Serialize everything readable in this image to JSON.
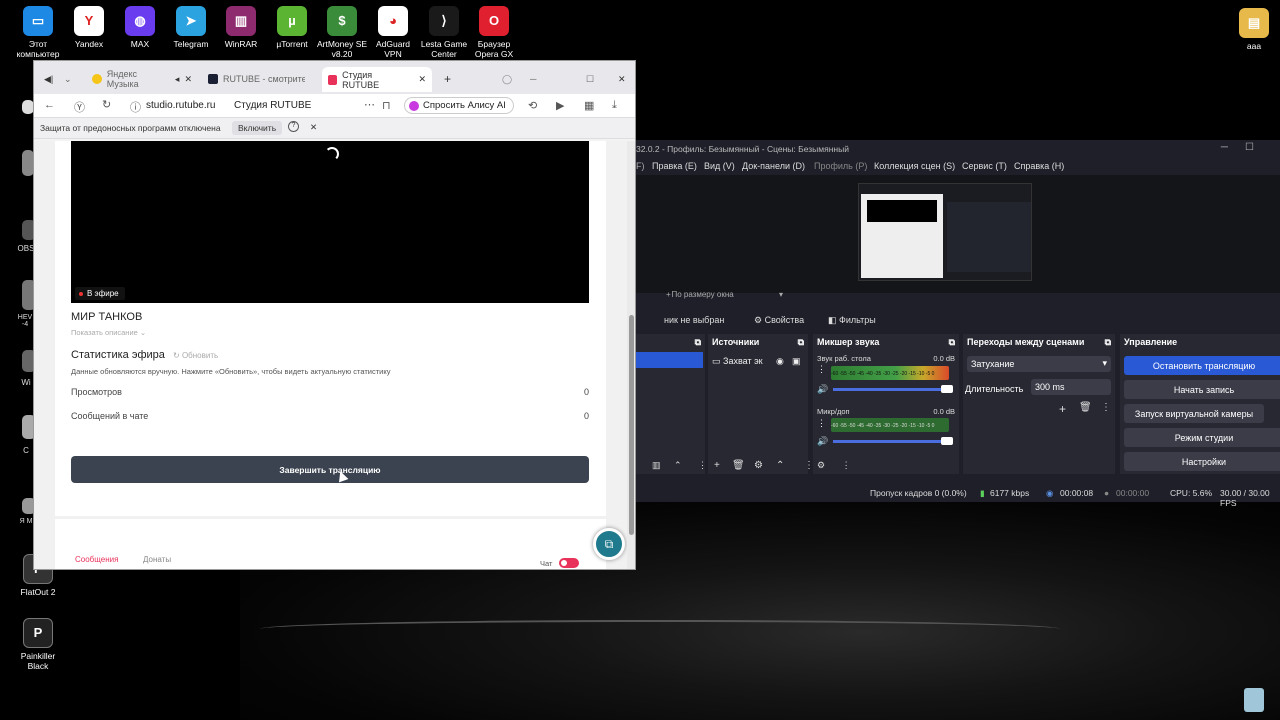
{
  "desktop": {
    "icons": [
      {
        "label": "Этот компьютер",
        "icon": "computer-icon",
        "color": "#1e88e5"
      },
      {
        "label": "Yandex",
        "icon": "yandex-icon",
        "color": "#ffffff"
      },
      {
        "label": "MAX",
        "icon": "max-icon",
        "color": "#6a3cf0"
      },
      {
        "label": "Telegram",
        "icon": "telegram-icon",
        "color": "#2aa3e0"
      },
      {
        "label": "WinRAR",
        "icon": "winrar-icon",
        "color": "#8e2b6e"
      },
      {
        "label": "µTorrent",
        "icon": "utorrent-icon",
        "color": "#5bb533"
      },
      {
        "label": "ArtMoney SE v8.20",
        "icon": "artmoney-icon",
        "color": "#3a8c3a"
      },
      {
        "label": "AdGuard VPN",
        "icon": "adguard-icon",
        "color": "#ffffff"
      },
      {
        "label": "Lesta Game Center",
        "icon": "lesta-icon",
        "color": "#1a1a1a"
      },
      {
        "label": "Браузер Opera GX",
        "icon": "opera-icon",
        "color": "#e0202f"
      }
    ],
    "right_icon": {
      "label": "ааа",
      "icon": "folder-icon"
    },
    "left_icons": [
      {
        "label": "FlatOut 2",
        "icon": "flatout-icon"
      },
      {
        "label": "Painkiller Black",
        "icon": "painkiller-icon"
      }
    ],
    "partial_labels": [
      "OBS",
      "HEV -4",
      "Wi",
      "C",
      "Я M"
    ],
    "recycle_icon": "recycle-bin-icon"
  },
  "browser": {
    "tabs": [
      {
        "label": "Яндекс Музыка",
        "active": false
      },
      {
        "label": "RUTUBE - смотрите в",
        "active": false
      },
      {
        "label": "Студия RUTUBE",
        "active": true
      }
    ],
    "address": {
      "domain": "studio.rutube.ru",
      "page_title": "Студия RUTUBE"
    },
    "alice_label": "Спросить Алису AI",
    "infobar": {
      "text": "Защита от предоносных программ отключена",
      "enable_label": "Включить"
    },
    "page": {
      "live_badge": "В эфире",
      "stream_title": "МИР ТАНКОВ",
      "show_description": "Показать описание",
      "stats_title": "Статистика эфира",
      "refresh_label": "Обновить",
      "stats_note": "Данные обновляются вручную. Нажмите «Обновить», чтобы видеть актуальную статистику",
      "stats": [
        {
          "label": "Просмотров",
          "value": "0"
        },
        {
          "label": "Сообщений в чате",
          "value": "0"
        }
      ],
      "end_button": "Завершить трансляцию",
      "bottom_tabs": [
        "Сообщения",
        "Донаты"
      ],
      "chat_label": "Чат"
    }
  },
  "obs": {
    "title": "32.0.2 - Профиль: Безымянный - Сцены: Безымянный",
    "menu": [
      "Правка (E)",
      "Вид (V)",
      "Док-панели (D)",
      "Профиль (P)",
      "Коллекция сцен (S)",
      "Сервис (T)",
      "Справка (H)"
    ],
    "scene_zoom": "По размеру окна",
    "no_source": "ник не выбран",
    "properties_label": "Свойства",
    "filters_label": "Фильтры",
    "docks": {
      "sources": {
        "title": "Источники",
        "items": [
          "Захват эк"
        ]
      },
      "mixer": {
        "title": "Микшер звука",
        "channels": [
          {
            "name": "Звук раб. стола",
            "db": "0.0 dB"
          },
          {
            "name": "Микр/доп",
            "db": "0.0 dB"
          }
        ],
        "scale": "-60 -55 -50 -45 -40 -35 -30 -25 -20 -15 -10 -5 0"
      },
      "transitions": {
        "title": "Переходы между сценами",
        "type": "Затухание",
        "duration_label": "Длительность",
        "duration_value": "300 ms"
      },
      "controls": {
        "title": "Управление",
        "buttons": [
          "Остановить трансляцию",
          "Начать запись",
          "Запуск виртуальной камеры",
          "Режим студии",
          "Настройки"
        ]
      }
    },
    "status": {
      "dropped": "Пропуск кадров 0 (0.0%)",
      "bitrate": "6177 kbps",
      "stream_time": "00:00:08",
      "rec_time": "00:00:00",
      "cpu": "CPU: 5.6%",
      "fps": "30.00 / 30.00 FPS"
    }
  }
}
